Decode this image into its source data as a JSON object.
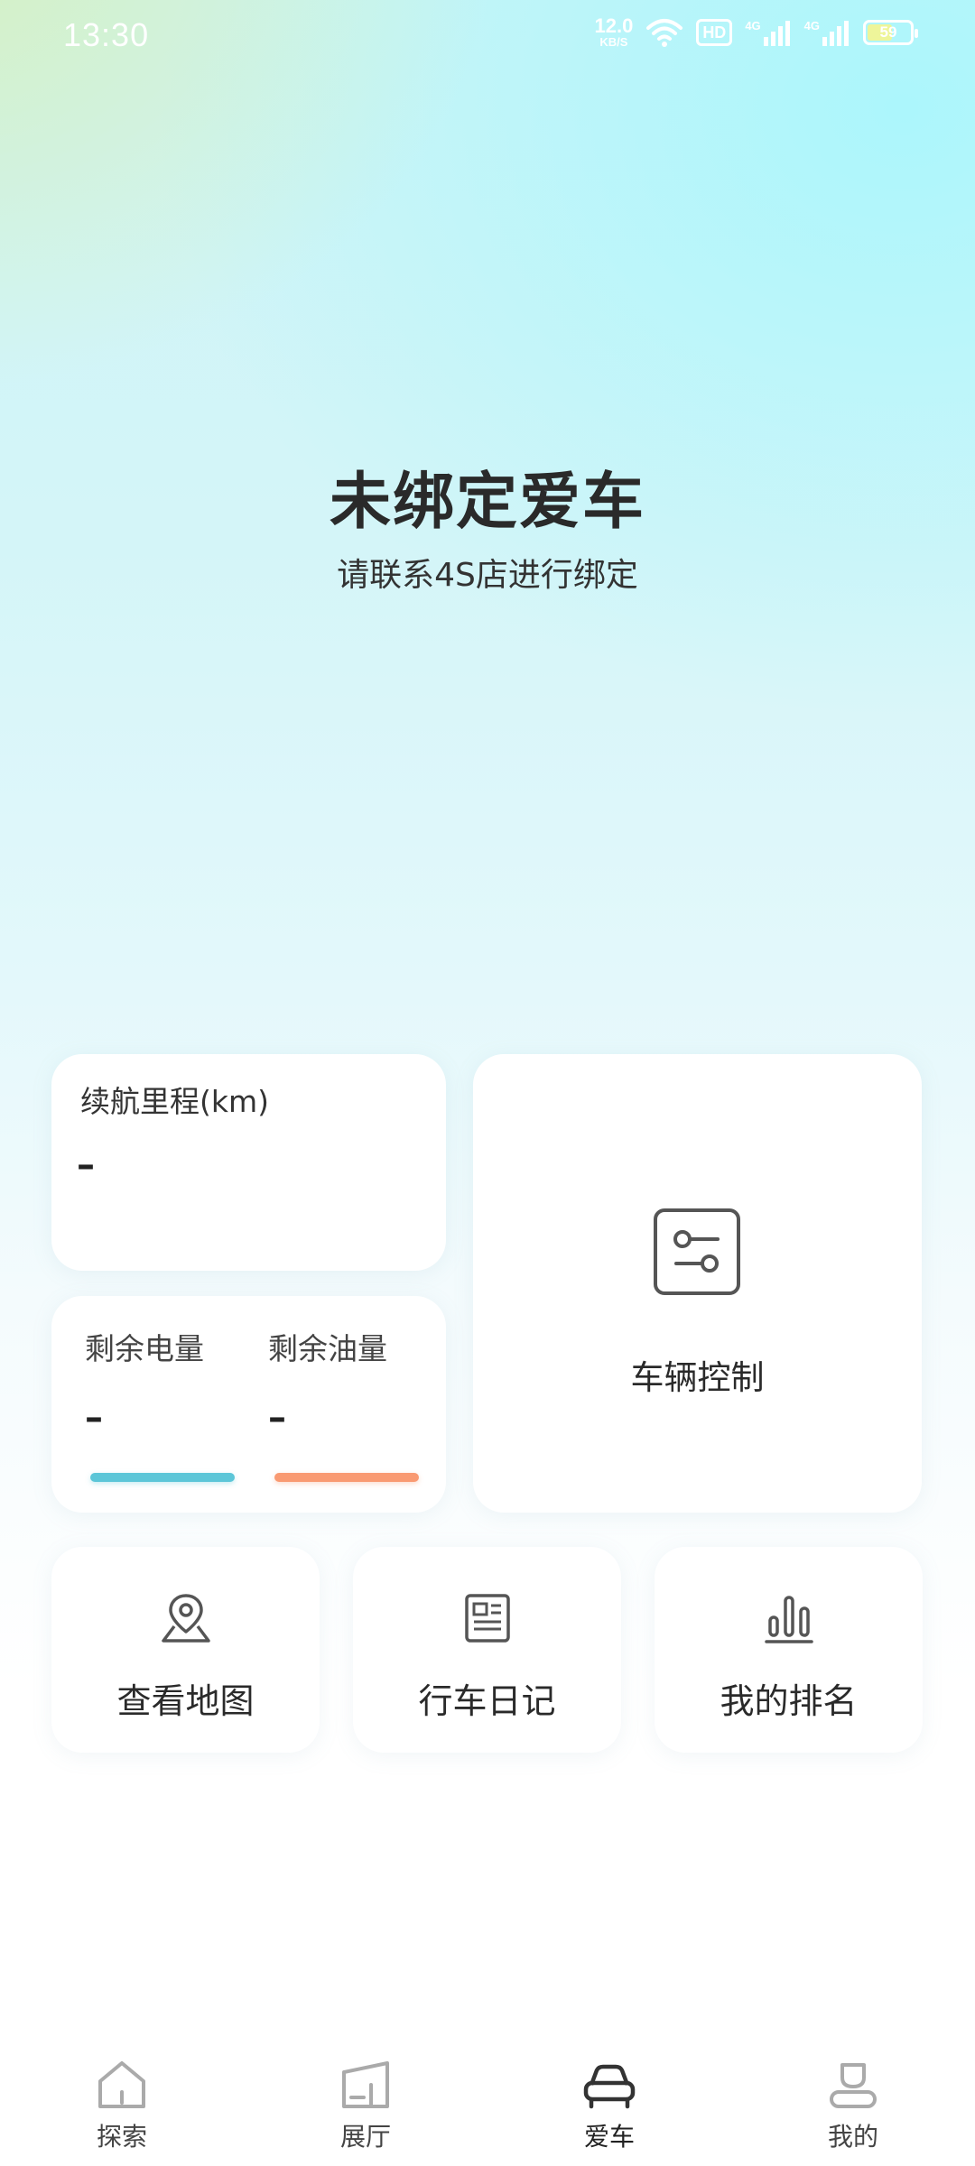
{
  "status_bar": {
    "time": "13:30",
    "net_speed_value": "12.0",
    "net_speed_unit": "KB/S",
    "hd_label": "HD",
    "signal_1_label": "4G",
    "signal_2_label": "4G",
    "battery_level": "59",
    "battery_fill_percent": 59,
    "icons": [
      "wifi-icon",
      "hd-icon",
      "signal-icon",
      "signal-icon",
      "battery-icon"
    ]
  },
  "hero": {
    "title": "未绑定爱车",
    "subtitle": "请联系4S店进行绑定"
  },
  "range_card": {
    "label": "续航里程(km)",
    "value": "–"
  },
  "energy_card": {
    "battery_label": "剩余电量",
    "battery_value": "–",
    "fuel_label": "剩余油量",
    "fuel_value": "–",
    "battery_bar_color": "#5cc6d8",
    "fuel_bar_color": "#f99a72"
  },
  "control_card": {
    "label": "车辆控制",
    "icon": "sliders-icon"
  },
  "tiles": [
    {
      "label": "查看地图",
      "icon": "map-pin-icon"
    },
    {
      "label": "行车日记",
      "icon": "diary-icon"
    },
    {
      "label": "我的排名",
      "icon": "bar-chart-icon"
    }
  ],
  "bottom_nav": {
    "items": [
      {
        "label": "探索",
        "icon": "home-icon"
      },
      {
        "label": "展厅",
        "icon": "showroom-icon"
      },
      {
        "label": "爱车",
        "icon": "car-icon"
      },
      {
        "label": "我的",
        "icon": "profile-icon"
      }
    ],
    "active_index": 2
  }
}
